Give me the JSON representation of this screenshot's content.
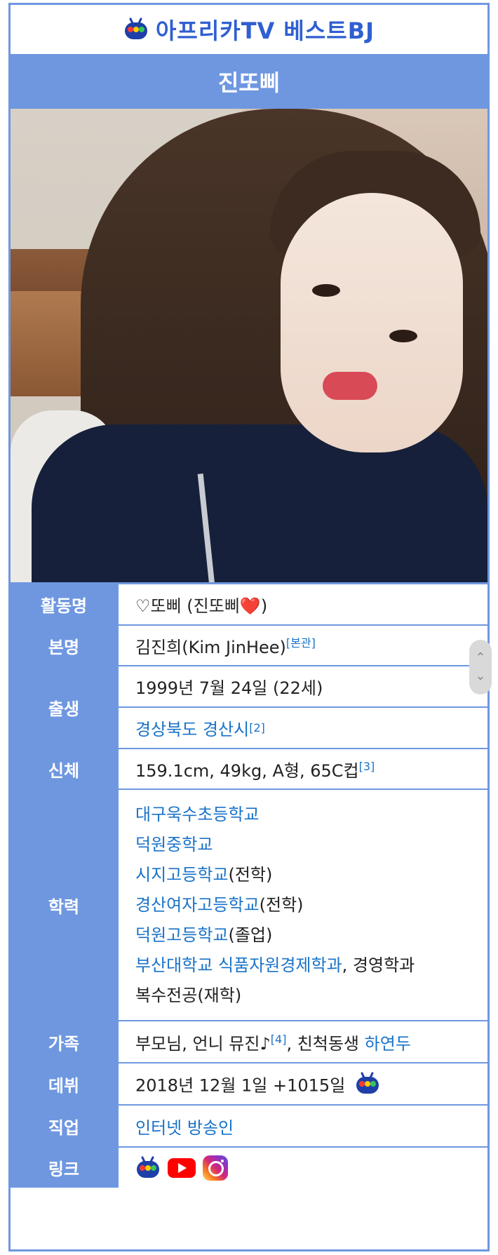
{
  "brand": {
    "title": "아프리카TV 베스트BJ",
    "logo_icon": "afreecatv-logo-icon"
  },
  "name_bar": "진또삐",
  "photo": {
    "alt": "profile-photo"
  },
  "rows": {
    "activity_name": {
      "label": "활동명",
      "value_prefix": "♡또삐 (진또삐",
      "heart": "❤️",
      "value_suffix": ")"
    },
    "real_name": {
      "label": "본명",
      "value": "김진희(Kim JinHee)",
      "sup": "[본관]"
    },
    "birth": {
      "label": "출생",
      "date": "1999년 7월 24일 (22세)",
      "place": "경상북도 경산시",
      "place_sup": "[2]"
    },
    "body": {
      "label": "신체",
      "value": "159.1cm, 49kg, A형, 65C컵",
      "sup": "[3]"
    },
    "education": {
      "label": "학력",
      "lines": [
        {
          "link": "대구욱수초등학교",
          "rest": ""
        },
        {
          "link": "덕원중학교",
          "rest": ""
        },
        {
          "link": "시지고등학교",
          "rest": "(전학)"
        },
        {
          "link": "경산여자고등학교",
          "rest": "(전학)"
        },
        {
          "link": "덕원고등학교",
          "rest": "(졸업)"
        },
        {
          "link": "부산대학교 식품자원경제학과",
          "rest": ", 경영학과"
        },
        {
          "link": "",
          "rest": "복수전공(재학)"
        }
      ]
    },
    "family": {
      "label": "가족",
      "text1": "부모님, 언니 뮤진♪",
      "sup": "[4]",
      "text2": ", 친척동생 ",
      "link": "하연두"
    },
    "debut": {
      "label": "데뷔",
      "value": "2018년 12월 1일 +1015일"
    },
    "job": {
      "label": "직업",
      "value": "인터넷 방송인"
    },
    "links": {
      "label": "링크",
      "icons": [
        "afreecatv-icon",
        "youtube-icon",
        "instagram-icon"
      ]
    }
  },
  "colors": {
    "accent": "#6f97e0",
    "link": "#1a73c9",
    "brand_text": "#2f5fd0"
  }
}
